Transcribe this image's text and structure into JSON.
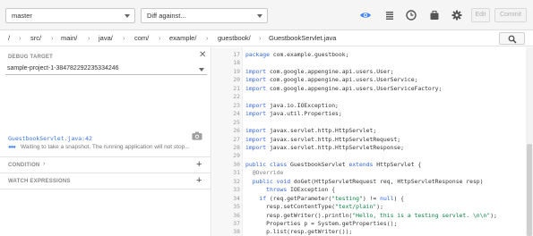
{
  "toolbar": {
    "branch": "master",
    "diff_placeholder": "Diff against...",
    "edit_label": "Edit",
    "commit_label": "Commit",
    "accent_color": "#4285f4"
  },
  "breadcrumb": {
    "items": [
      "/",
      "src/",
      "main/",
      "java/",
      "com/",
      "example/",
      "guestbook/",
      "GuestbookServlet.java"
    ]
  },
  "debug": {
    "target_label": "DEBUG TARGET",
    "target_value": "sample-project-1-384782292235334246",
    "snapshot_link": "GuestbookServlet.java:42",
    "snapshot_status": "Waiting to take a snapshot. The running application will not stop...",
    "condition_label": "CONDITION",
    "watch_label": "WATCH EXPRESSIONS"
  },
  "code": {
    "lines": [
      {
        "n": "17",
        "t": "package com.example.guestbook;"
      },
      {
        "n": "18",
        "t": ""
      },
      {
        "n": "19",
        "t": "import com.google.appengine.api.users.User;"
      },
      {
        "n": "20",
        "t": "import com.google.appengine.api.users.UserService;"
      },
      {
        "n": "21",
        "t": "import com.google.appengine.api.users.UserServiceFactory;"
      },
      {
        "n": "22",
        "t": ""
      },
      {
        "n": "23",
        "t": "import java.io.IOException;"
      },
      {
        "n": "24",
        "t": "import java.util.Properties;"
      },
      {
        "n": "25",
        "t": ""
      },
      {
        "n": "26",
        "t": "import javax.servlet.http.HttpServlet;"
      },
      {
        "n": "27",
        "t": "import javax.servlet.http.HttpServletRequest;"
      },
      {
        "n": "28",
        "t": "import javax.servlet.http.HttpServletResponse;"
      },
      {
        "n": "29",
        "t": ""
      },
      {
        "n": "30",
        "t": "public class GuestbookServlet extends HttpServlet {"
      },
      {
        "n": "31",
        "t": "  @Override"
      },
      {
        "n": "32",
        "t": "  public void doGet(HttpServletRequest req, HttpServletResponse resp)"
      },
      {
        "n": "33",
        "t": "      throws IOException {"
      },
      {
        "n": "34",
        "t": "    if (req.getParameter(\"testing\") != null) {"
      },
      {
        "n": "35",
        "t": "      resp.setContentType(\"text/plain\");"
      },
      {
        "n": "36",
        "t": "      resp.getWriter().println(\"Hello, this is a testing servlet. \\n\\n\");"
      },
      {
        "n": "37",
        "t": "      Properties p = System.getProperties();"
      },
      {
        "n": "38",
        "t": "      p.list(resp.getWriter());"
      }
    ]
  }
}
